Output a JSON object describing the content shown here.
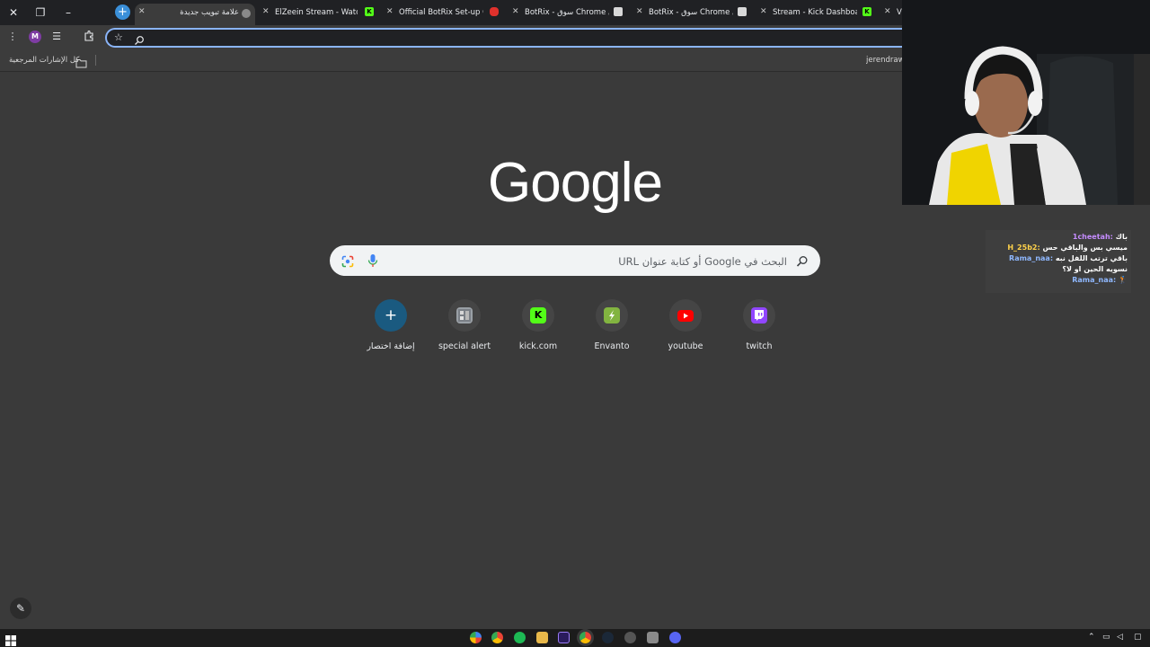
{
  "browser": {
    "tabs": [
      {
        "title": "علامة تبويب جديدة",
        "active": true,
        "favicon": "chrome-icon"
      },
      {
        "title": "ElZeein Stream - Watch L",
        "active": false,
        "favicon": "kick-icon"
      },
      {
        "title": "Official BotRix Set-up Gui",
        "active": false,
        "favicon": "youtube-icon"
      },
      {
        "title": "BotRix - سوق Chrome الإلكتروني",
        "active": false,
        "favicon": "image-icon"
      },
      {
        "title": "BotRix - سوق Chrome الإلكتروني",
        "active": false,
        "favicon": "image-icon"
      },
      {
        "title": "Stream - Kick Dashboard",
        "active": false,
        "favicon": "kick-icon"
      },
      {
        "title": "V",
        "active": false,
        "favicon": ""
      }
    ],
    "new_tab_symbol": "+",
    "window_controls": {
      "close": "✕",
      "restore": "❐",
      "minimize": "–"
    },
    "profile_initial": "M",
    "omnibox": {
      "value": "",
      "placeholder": ""
    },
    "bookmarks": {
      "all_bookmarks_label": "كل الإشارات المرجعية",
      "right_item": "jerendraws"
    }
  },
  "ntp": {
    "logo": "Google",
    "search_placeholder": "البحث في Google أو كتابة عنوان URL",
    "shortcuts": [
      {
        "label": "إضافة اختصار",
        "icon": "plus-icon",
        "color": "#1a73e8"
      },
      {
        "label": "special alert",
        "icon": "image-icon",
        "color": "#9aa0a6"
      },
      {
        "label": "kick.com",
        "icon": "kick-icon",
        "color": "#53fc18"
      },
      {
        "label": "Envanto",
        "icon": "envato-icon",
        "color": "#82b440"
      },
      {
        "label": "youtube",
        "icon": "youtube-icon",
        "color": "#ff0000"
      },
      {
        "label": "twitch",
        "icon": "twitch-icon",
        "color": "#9146ff"
      }
    ],
    "add_symbol": "+",
    "kick_letter": "K"
  },
  "chat": {
    "messages": [
      {
        "user": "1cheetah:",
        "text": "باك",
        "user_color": "#c58cff"
      },
      {
        "user": "H_25b2:",
        "text": "ميسي بس والباقي حس",
        "user_color": "#ffd24a"
      },
      {
        "user": "Rama_naa:",
        "text": "باقي ترتب اللفل نبه",
        "user_color": "#8fb8ff"
      },
      {
        "user": "",
        "text": "نسويه الحين او لا؟",
        "user_color": "#ffffff"
      },
      {
        "user": "Rama_naa:",
        "text": "",
        "user_color": "#8fb8ff"
      }
    ]
  },
  "colors": {
    "accent": "#8ab4f8",
    "ntp_background": "#3a3a3a",
    "toolbar": "#3c3c3c"
  }
}
